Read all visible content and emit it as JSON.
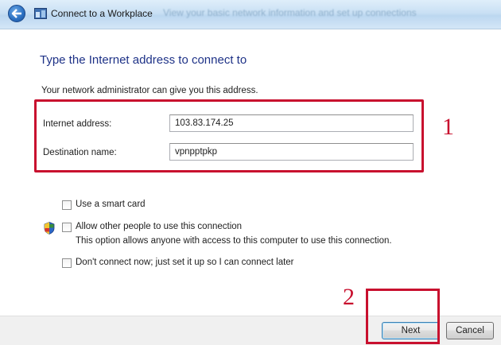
{
  "window": {
    "title": "Connect to a Workplace",
    "background_text": "View your basic network information and set up connections"
  },
  "content": {
    "heading": "Type the Internet address to connect to",
    "instruction": "Your network administrator can give you this address.",
    "fields": [
      {
        "label": "Internet address:",
        "value": "103.83.174.25"
      },
      {
        "label": "Destination name:",
        "value": "vpnpptpkp"
      }
    ],
    "options": {
      "smart_card": "Use a smart card",
      "allow_others": "Allow other people to use this connection",
      "allow_others_note": "This option allows anyone with access to this computer to use this connection.",
      "dont_connect": "Don't connect now; just set it up so I can connect later"
    },
    "annotations": {
      "step1": "1",
      "step2": "2"
    }
  },
  "buttons": {
    "next": "Next",
    "cancel": "Cancel"
  },
  "colors": {
    "heading": "#1e3287",
    "annotation_red": "#c8102e",
    "button_bar": "#f0f0f0"
  },
  "icons": [
    "back-arrow-icon",
    "workplace-network-icon",
    "uac-shield-icon"
  ]
}
